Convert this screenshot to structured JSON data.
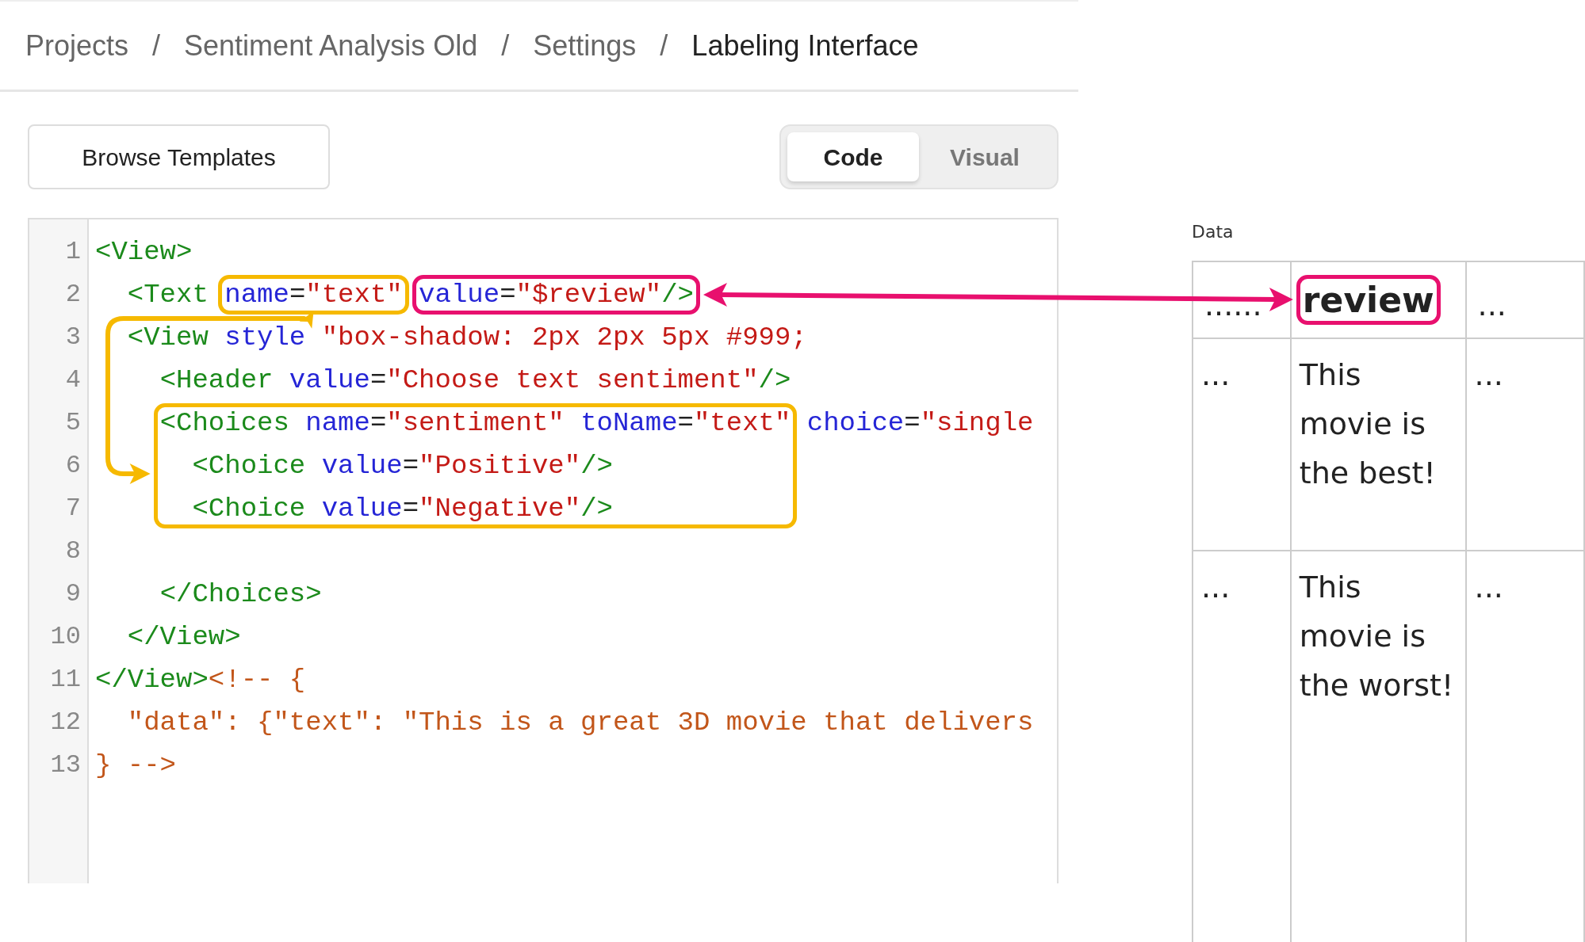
{
  "breadcrumb": [
    {
      "label": "Projects",
      "current": false,
      "separator": "/"
    },
    {
      "label": "Sentiment Analysis Old",
      "current": false,
      "separator": "/"
    },
    {
      "label": "Settings",
      "current": false,
      "separator": "/"
    },
    {
      "label": "Labeling Interface",
      "current": true
    }
  ],
  "toolbar": {
    "browse_button": "Browse Templates",
    "tabs": [
      {
        "label": "Code",
        "selected": true
      },
      {
        "label": "Visual",
        "selected": false
      }
    ]
  },
  "editor": {
    "lines": [
      {
        "number": "1",
        "segments": [
          {
            "text": "<View>"
          }
        ]
      },
      {
        "number": "2",
        "segments": [
          {
            "text": "  <Text "
          },
          {
            "text": "name=\"text\" ",
            "color": "#f6b900"
          },
          {
            "text": "value=\"$review\"/>",
            "color": "#e8106e"
          }
        ]
      },
      {
        "number": "3",
        "segments": [
          {
            "text": "  <View style \"box-shadow: 2px 2px 5px #999;"
          }
        ]
      },
      {
        "number": "4",
        "segments": [
          {
            "text": "    <Header value=\"Choose text sentiment\"/>"
          }
        ]
      },
      {
        "number": "5",
        "segments": [
          {
            "text": "    <Choices name=\"sentiment\" toName=\"text\" ",
            "color": "#f6b900"
          },
          {
            "text": "choice=\"single"
          }
        ]
      },
      {
        "number": "6",
        "segments": [
          {
            "text": "      <Choice value=\"Positive\"/>",
            "color": "#f6b900"
          }
        ]
      },
      {
        "number": "7",
        "segments": [
          {
            "text": "      <Choice value=\"Negative\"/>",
            "color": "#f6b900"
          }
        ]
      },
      {
        "number": "8"
      },
      {
        "number": "9",
        "segments": [
          {
            "text": "    </Choices>"
          }
        ]
      },
      {
        "number": "10",
        "segments": [
          {
            "text": "  </View>"
          }
        ]
      },
      {
        "number": "11",
        "segments": [
          {
            "text": "</View><!-- {"
          }
        ]
      },
      {
        "number": "12",
        "segments": [
          {
            "text": "  \"data\": {\"text\": \"This is a great 3D movie that delivers"
          }
        ]
      },
      {
        "number": "13",
        "segments": [
          {
            "text": "} -->"
          }
        ]
      }
    ]
  },
  "data_panel": {
    "label": "Data",
    "columns": [
      {
        "label": "......"
      },
      {
        "label": "review",
        "color": "#e8106e"
      },
      {
        "label": "..."
      }
    ],
    "rows": [
      [
        "...",
        "This movie is the best!",
        "..."
      ],
      [
        "...",
        "This movie is the worst!",
        "..."
      ]
    ]
  },
  "connectors": [
    {
      "kind": "straight",
      "color": "#e8106e"
    },
    {
      "kind": "curved",
      "color": "#f6b900"
    }
  ]
}
